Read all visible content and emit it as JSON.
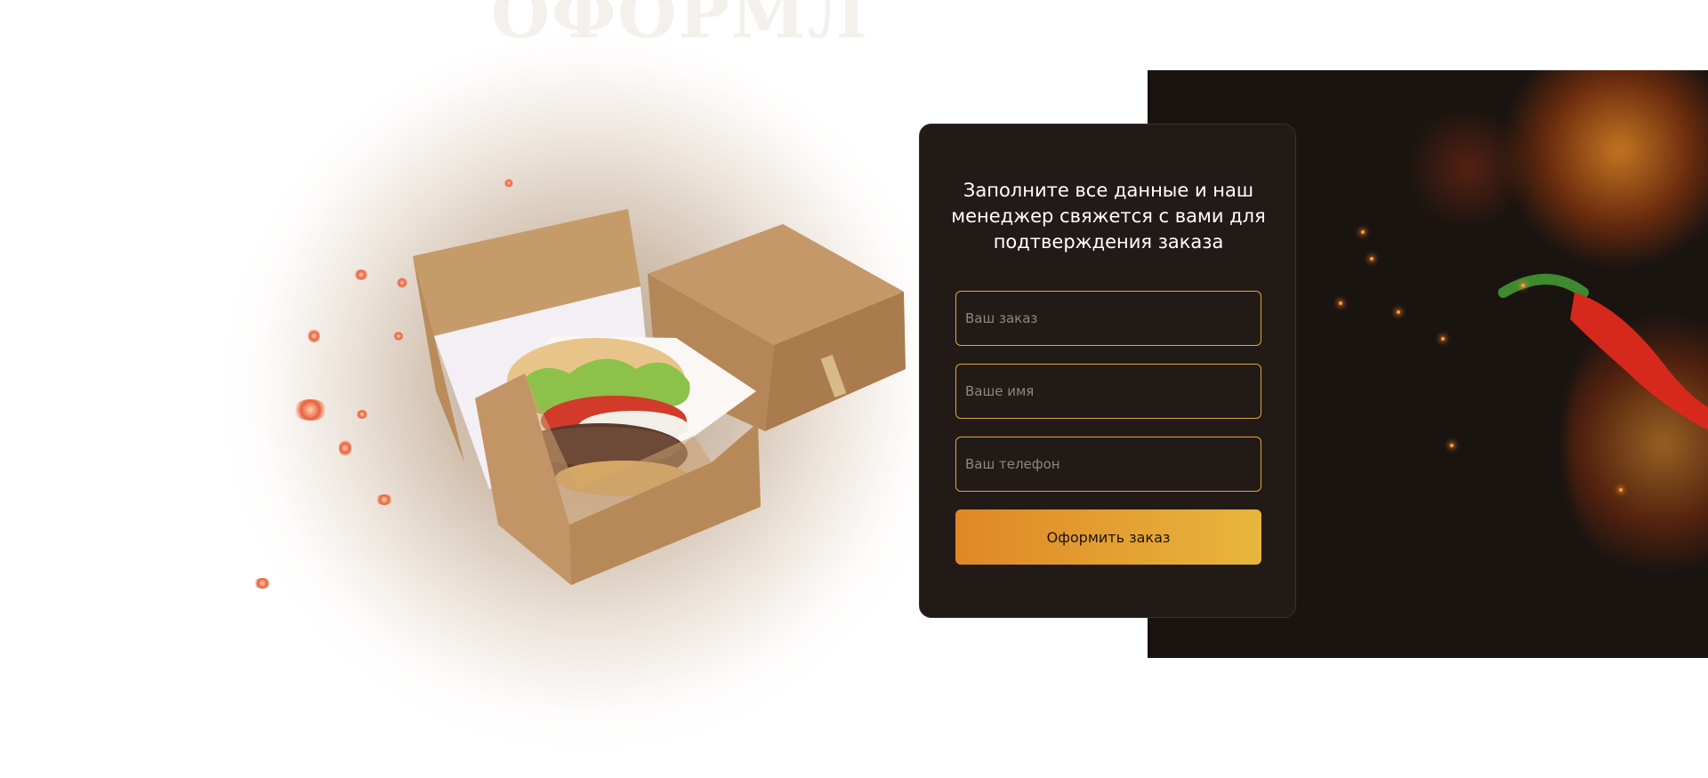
{
  "section": {
    "title": "ОФОРМЛЕ"
  },
  "form": {
    "heading": "Заполните все данные и наш менеджер свяжется с вами для подтверждения заказа",
    "order_placeholder": "Ваш заказ",
    "name_placeholder": "Ваше имя",
    "phone_placeholder": "Ваш телефон",
    "submit_label": "Оформить заказ"
  },
  "colors": {
    "card_background": "#221a17",
    "field_border": "#e0a53c",
    "button_gradient_start": "#df8726",
    "button_gradient_end": "#e8b63c",
    "fire_panel_background": "#1a1411"
  },
  "images": {
    "burger_box": "burger-box-illustration",
    "fire_panel": "fire-and-chili-illustration"
  }
}
